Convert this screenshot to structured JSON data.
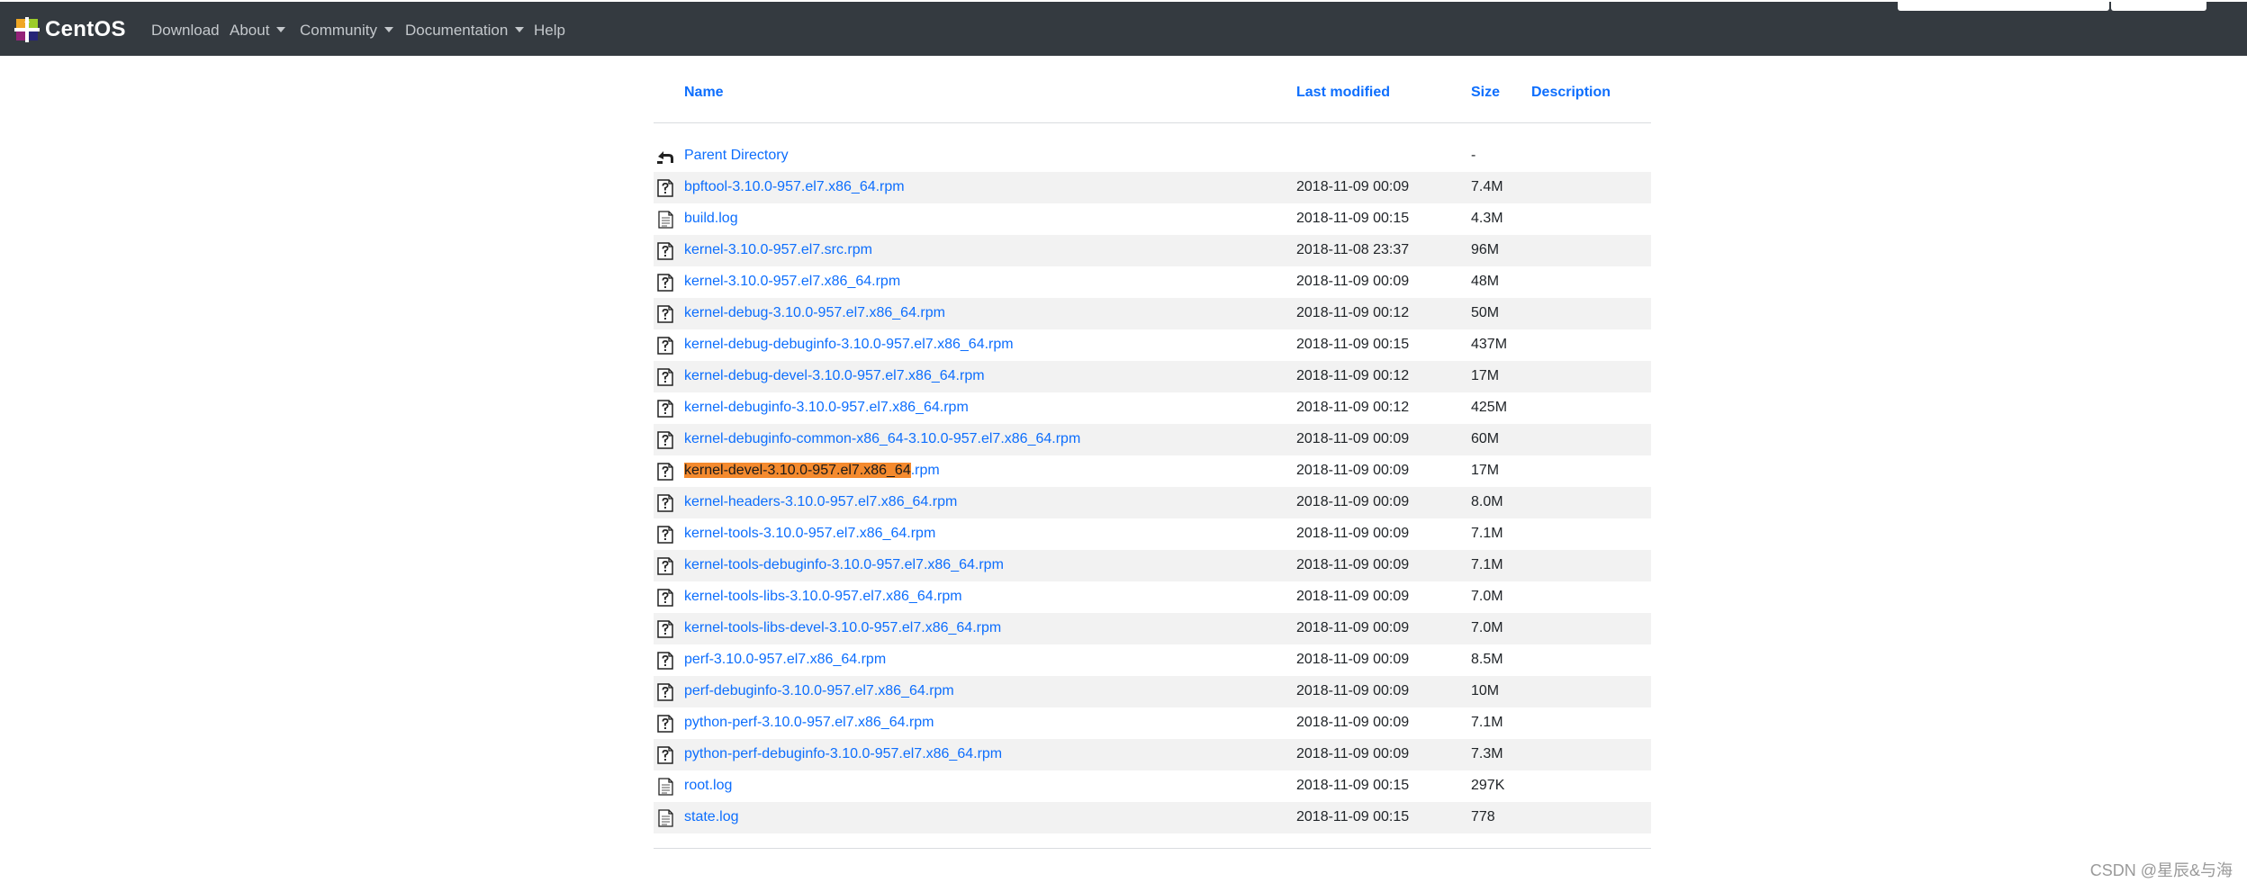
{
  "navbar": {
    "brand": "CentOS",
    "items": [
      {
        "label": "Download",
        "dropdown": false
      },
      {
        "label": "About",
        "dropdown": true
      },
      {
        "label": "Community",
        "dropdown": true
      },
      {
        "label": "Documentation",
        "dropdown": true
      },
      {
        "label": "Help",
        "dropdown": false
      }
    ]
  },
  "table": {
    "headers": {
      "name": "Name",
      "last_modified": "Last modified",
      "size": "Size",
      "description": "Description"
    },
    "parent": {
      "name": "Parent Directory",
      "size": "-",
      "icon": "back-arrow-icon"
    },
    "rows": [
      {
        "name": "bpftool-3.10.0-957.el7.x86_64.rpm",
        "date": "2018-11-09 00:09",
        "size": "7.4M",
        "icon": "unknown-file-icon"
      },
      {
        "name": "build.log",
        "date": "2018-11-09 00:15",
        "size": "4.3M",
        "icon": "text-file-icon"
      },
      {
        "name": "kernel-3.10.0-957.el7.src.rpm",
        "date": "2018-11-08 23:37",
        "size": "96M",
        "icon": "unknown-file-icon"
      },
      {
        "name": "kernel-3.10.0-957.el7.x86_64.rpm",
        "date": "2018-11-09 00:09",
        "size": "48M",
        "icon": "unknown-file-icon"
      },
      {
        "name": "kernel-debug-3.10.0-957.el7.x86_64.rpm",
        "date": "2018-11-09 00:12",
        "size": "50M",
        "icon": "unknown-file-icon"
      },
      {
        "name": "kernel-debug-debuginfo-3.10.0-957.el7.x86_64.rpm",
        "date": "2018-11-09 00:15",
        "size": "437M",
        "icon": "unknown-file-icon"
      },
      {
        "name": "kernel-debug-devel-3.10.0-957.el7.x86_64.rpm",
        "date": "2018-11-09 00:12",
        "size": "17M",
        "icon": "unknown-file-icon"
      },
      {
        "name": "kernel-debuginfo-3.10.0-957.el7.x86_64.rpm",
        "date": "2018-11-09 00:12",
        "size": "425M",
        "icon": "unknown-file-icon"
      },
      {
        "name": "kernel-debuginfo-common-x86_64-3.10.0-957.el7.x86_64.rpm",
        "date": "2018-11-09 00:09",
        "size": "60M",
        "icon": "unknown-file-icon"
      },
      {
        "name": "kernel-devel-3.10.0-957.el7.x86_64.rpm",
        "highlight": "kernel-devel-3.10.0-957.el7.x86_64",
        "rest": ".rpm",
        "date": "2018-11-09 00:09",
        "size": "17M",
        "icon": "unknown-file-icon"
      },
      {
        "name": "kernel-headers-3.10.0-957.el7.x86_64.rpm",
        "date": "2018-11-09 00:09",
        "size": "8.0M",
        "icon": "unknown-file-icon"
      },
      {
        "name": "kernel-tools-3.10.0-957.el7.x86_64.rpm",
        "date": "2018-11-09 00:09",
        "size": "7.1M",
        "icon": "unknown-file-icon"
      },
      {
        "name": "kernel-tools-debuginfo-3.10.0-957.el7.x86_64.rpm",
        "date": "2018-11-09 00:09",
        "size": "7.1M",
        "icon": "unknown-file-icon"
      },
      {
        "name": "kernel-tools-libs-3.10.0-957.el7.x86_64.rpm",
        "date": "2018-11-09 00:09",
        "size": "7.0M",
        "icon": "unknown-file-icon"
      },
      {
        "name": "kernel-tools-libs-devel-3.10.0-957.el7.x86_64.rpm",
        "date": "2018-11-09 00:09",
        "size": "7.0M",
        "icon": "unknown-file-icon"
      },
      {
        "name": "perf-3.10.0-957.el7.x86_64.rpm",
        "date": "2018-11-09 00:09",
        "size": "8.5M",
        "icon": "unknown-file-icon"
      },
      {
        "name": "perf-debuginfo-3.10.0-957.el7.x86_64.rpm",
        "date": "2018-11-09 00:09",
        "size": "10M",
        "icon": "unknown-file-icon"
      },
      {
        "name": "python-perf-3.10.0-957.el7.x86_64.rpm",
        "date": "2018-11-09 00:09",
        "size": "7.1M",
        "icon": "unknown-file-icon"
      },
      {
        "name": "python-perf-debuginfo-3.10.0-957.el7.x86_64.rpm",
        "date": "2018-11-09 00:09",
        "size": "7.3M",
        "icon": "unknown-file-icon"
      },
      {
        "name": "root.log",
        "date": "2018-11-09 00:15",
        "size": "297K",
        "icon": "text-file-icon"
      },
      {
        "name": "state.log",
        "date": "2018-11-09 00:15",
        "size": "778",
        "icon": "text-file-icon"
      }
    ]
  },
  "watermark": "CSDN @星辰&与海",
  "colors": {
    "navbar_bg": "#343a40",
    "link": "#0d6efd",
    "highlight": "#f48a2e",
    "stripe": "#f2f2f2"
  }
}
